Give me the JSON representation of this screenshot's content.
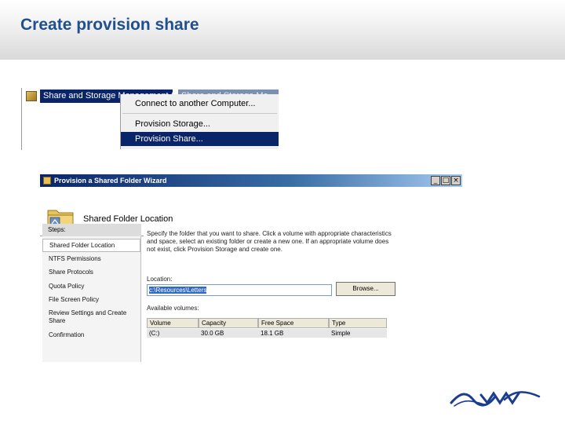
{
  "slide": {
    "title": "Create provision share"
  },
  "context_screenshot": {
    "tree_node": "Share and Storage Management (",
    "tree_node_secondary": "Share and Storage Ma",
    "menu_items": [
      {
        "label": "Connect to another Computer..."
      },
      {
        "label": "Provision Storage..."
      },
      {
        "label": "Provision Share...",
        "selected": true
      }
    ]
  },
  "wizard": {
    "title": "Provision a Shared Folder Wizard",
    "heading": "Shared Folder Location",
    "steps_header": "Steps:",
    "steps": [
      {
        "label": "Shared Folder Location",
        "current": true
      },
      {
        "label": "NTFS Permissions"
      },
      {
        "label": "Share Protocols"
      },
      {
        "label": "Quota Policy"
      },
      {
        "label": "File Screen Policy"
      },
      {
        "label": "Review Settings and Create Share"
      },
      {
        "label": "Confirmation"
      }
    ],
    "description": "Specify the folder that you want to share. Click a volume with appropriate characteristics and space, select an existing folder or create a new one. If an appropriate volume does not exist, click Provision Storage and create one.",
    "location_label": "Location:",
    "location_value": "c:\\Resources\\Letters",
    "browse_label": "Browse...",
    "volumes_label": "Available volumes:",
    "columns": [
      "Volume",
      "Capacity",
      "Free Space",
      "Type"
    ],
    "volumes": [
      {
        "volume": "(C:)",
        "capacity": "30.0 GB",
        "free_space": "18.1 GB",
        "type": "Simple"
      }
    ]
  },
  "colors": {
    "title": "#1f4f8f",
    "selection": "#0a246a",
    "logo": "#1a3d8f"
  }
}
